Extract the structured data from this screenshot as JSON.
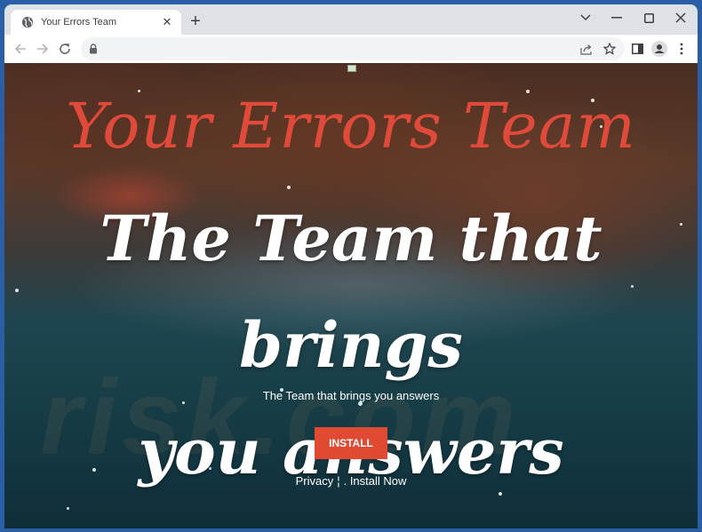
{
  "browser": {
    "tab": {
      "title": "Your Errors Team",
      "favicon": "globe-icon",
      "close": "✕"
    },
    "new_tab": "+",
    "window_controls": {
      "tab_search": "chevron-down-icon",
      "minimize": "minimize-icon",
      "maximize": "maximize-icon",
      "close": "close-icon"
    },
    "address_bar": {
      "value": "",
      "placeholder": ""
    },
    "toolbar_icons": [
      "share-icon",
      "bookmark-star-icon",
      "side-panel-icon",
      "profile-icon",
      "menu-icon"
    ]
  },
  "page": {
    "brand_title": "Your Errors Team",
    "headline_line1": "The Team that brings",
    "headline_line2": "you answers",
    "subline": "The Team that brings you answers",
    "install_button": "INSTALL",
    "footer": {
      "privacy": "Privacy",
      "separator": "¦",
      "install_now": ". Install Now"
    },
    "watermark": "risk.com",
    "accent_color": "#e04a32"
  }
}
